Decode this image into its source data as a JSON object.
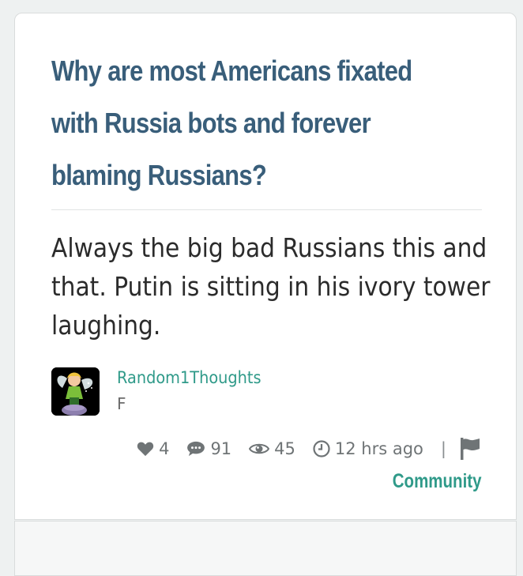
{
  "post": {
    "title": "Why are most Americans fixated with Russia bots and forever blaming Russians?",
    "body": "Always the big bad Russians this and that. Putin is sitting in his ivory tower laughing.",
    "author": {
      "name": "Random1Thoughts",
      "gender": "F",
      "avatar_icon": "fairy-avatar"
    },
    "stats": {
      "likes": "4",
      "likes_icon": "heart-icon",
      "comments": "91",
      "comments_icon": "speech-bubble-icon",
      "views": "45",
      "views_icon": "eye-icon",
      "time": "12 hrs ago",
      "time_icon": "clock-icon",
      "separator": "|",
      "report_icon": "flag-icon"
    },
    "category": "Community"
  },
  "colors": {
    "title": "#395e7a",
    "accent": "#2f9a89",
    "body_text": "#2b2b2b",
    "meta_text": "#6f7476",
    "background": "#eef1f1",
    "card": "#ffffff"
  }
}
